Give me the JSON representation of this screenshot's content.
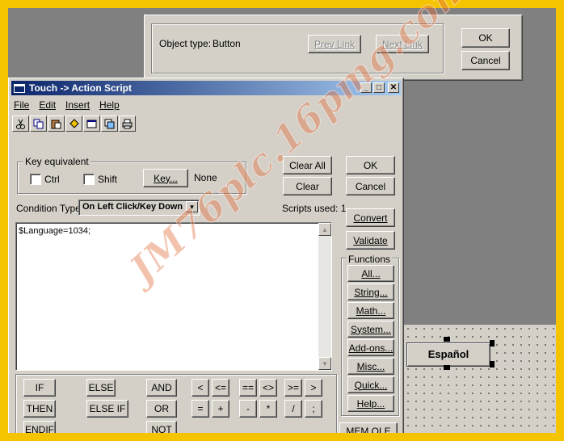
{
  "object_dialog": {
    "object_type_label": "Object type:",
    "object_type_value": "Button",
    "prev_link": "Prev Link",
    "next_link": "Next Link",
    "ok": "OK",
    "cancel": "Cancel"
  },
  "script_window": {
    "title": "Touch -> Action Script",
    "menu": [
      "File",
      "Edit",
      "Insert",
      "Help"
    ],
    "toolbar_icons": [
      "cut-icon",
      "copy-icon",
      "paste-icon",
      "highlighter-icon",
      "window-icon",
      "convert-icon",
      "print-icon"
    ],
    "key_equivalent_label": "Key equivalent",
    "ctrl_label": "Ctrl",
    "shift_label": "Shift",
    "key_button": "Key...",
    "key_value": "None",
    "clear_all": "Clear All",
    "clear": "Clear",
    "ok": "OK",
    "cancel": "Cancel",
    "condition_type_label": "Condition Type:",
    "condition_type_value": "On Left Click/Key Down",
    "scripts_used": "Scripts used: 1",
    "script_text": "$Language=1034;",
    "convert": "Convert",
    "validate": "Validate",
    "functions_label": "Functions",
    "functions": [
      "All...",
      "String...",
      "Math...",
      "System...",
      "Add-ons...",
      "Misc...",
      "Quick...",
      "Help..."
    ],
    "mem_ole": "MEM OLE",
    "keywords": {
      "if": "IF",
      "then": "THEN",
      "endif": "ENDIF",
      "else": "ELSE",
      "else_if": "ELSE IF",
      "and": "AND",
      "or": "OR",
      "not": "NOT"
    },
    "operators": [
      "<",
      "<=",
      "==",
      "<>",
      ">=",
      ">",
      "=",
      "+",
      "-",
      "*",
      "/",
      ";"
    ]
  },
  "canvas_button": {
    "label": "Español"
  },
  "watermark": "JM76plc.16pmg.com",
  "colors": {
    "frame": "#f5c400",
    "title_start": "#0a246a",
    "title_end": "#a6caf0",
    "face": "#d4d0c8"
  }
}
